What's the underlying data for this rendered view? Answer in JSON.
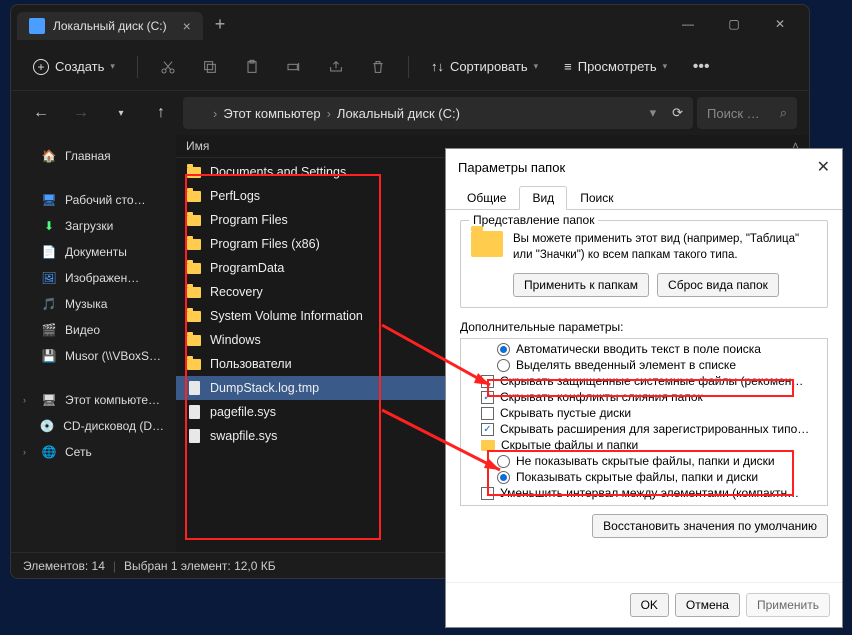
{
  "tab": {
    "title": "Локальный диск (C:)"
  },
  "toolbar": {
    "new": "Создать",
    "sort": "Сортировать",
    "view": "Просмотреть"
  },
  "breadcrumb": {
    "root": "Этот компьютер",
    "current": "Локальный диск (C:)"
  },
  "search": {
    "placeholder": "Поиск …"
  },
  "sidebar": {
    "home": "Главная",
    "desktop": "Рабочий сто…",
    "downloads": "Загрузки",
    "documents": "Документы",
    "pictures": "Изображен…",
    "music": "Музыка",
    "videos": "Видео",
    "musor": "Musor (\\\\VBoxS…",
    "thispc": "Этот компьюте…",
    "cddrive": "CD-дисковод (D…",
    "network": "Сеть"
  },
  "column": {
    "name": "Имя"
  },
  "files": [
    {
      "name": "Documents and Settings",
      "type": "folder"
    },
    {
      "name": "PerfLogs",
      "type": "folder"
    },
    {
      "name": "Program Files",
      "type": "folder"
    },
    {
      "name": "Program Files (x86)",
      "type": "folder"
    },
    {
      "name": "ProgramData",
      "type": "folder"
    },
    {
      "name": "Recovery",
      "type": "folder"
    },
    {
      "name": "System Volume Information",
      "type": "folder"
    },
    {
      "name": "Windows",
      "type": "folder"
    },
    {
      "name": "Пользователи",
      "type": "folder"
    },
    {
      "name": "DumpStack.log.tmp",
      "type": "file",
      "selected": true
    },
    {
      "name": "pagefile.sys",
      "type": "file"
    },
    {
      "name": "swapfile.sys",
      "type": "file"
    }
  ],
  "status": {
    "count_label": "Элементов: 14",
    "selection_label": "Выбран 1 элемент: 12,0 КБ"
  },
  "dialog": {
    "title": "Параметры папок",
    "tabs": {
      "general": "Общие",
      "view": "Вид",
      "search": "Поиск"
    },
    "group1": {
      "legend": "Представление папок",
      "text": "Вы можете применить этот вид (например, \"Таблица\" или \"Значки\") ко всем папкам такого типа.",
      "apply": "Применить к папкам",
      "reset": "Сброс вида папок"
    },
    "adv_label": "Дополнительные параметры:",
    "tree": {
      "r1": "Автоматически вводить текст в поле поиска",
      "r2": "Выделять введенный элемент в списке",
      "c1": "Скрывать защищенные системные файлы (рекомен…",
      "c2": "Скрывать конфликты слияния папок",
      "c3": "Скрывать пустые диски",
      "c4": "Скрывать расширения для зарегистрированных типо…",
      "f1": "Скрытые файлы и папки",
      "r3": "Не показывать скрытые файлы, папки и диски",
      "r4": "Показывать скрытые файлы, папки и диски",
      "c5": "Уменьшить интервал между элементами (компактн…"
    },
    "reset_defaults": "Восстановить значения по умолчанию",
    "ok": "OK",
    "cancel": "Отмена",
    "apply": "Применить"
  }
}
